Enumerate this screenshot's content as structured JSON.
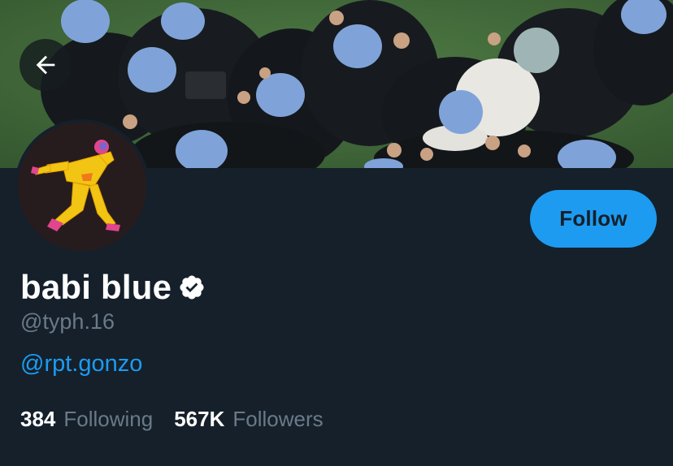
{
  "header": {
    "back_icon": "arrow-left-icon",
    "banner_description": "group-photo-banner"
  },
  "profile": {
    "display_name": "babi blue",
    "verified_icon": "verified-badge-icon",
    "handle": "@typh.16",
    "bio_link": "@rpt.gonzo",
    "follow_label": "Follow",
    "stats": {
      "following_count": "384",
      "following_label": "Following",
      "followers_count": "567K",
      "followers_label": "Followers"
    }
  },
  "colors": {
    "background": "#15202b",
    "accent": "#1d9bf0",
    "text_primary": "#ffffff",
    "text_secondary": "#6b7a88"
  }
}
